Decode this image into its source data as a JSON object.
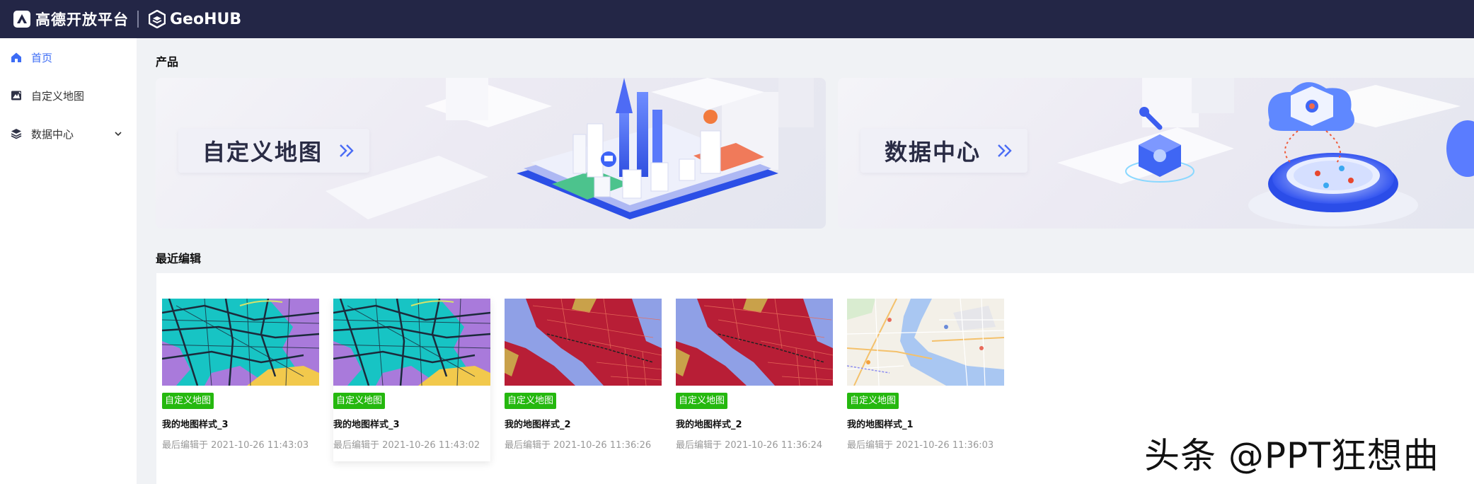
{
  "header": {
    "brand_name": "高德开放平台",
    "product_name": "GeoHUB"
  },
  "sidebar": {
    "items": [
      {
        "label": "首页",
        "icon": "home-icon",
        "active": true
      },
      {
        "label": "自定义地图",
        "icon": "custom-map-icon",
        "active": false
      },
      {
        "label": "数据中心",
        "icon": "layers-icon",
        "active": false,
        "expandable": true
      }
    ]
  },
  "products": {
    "title": "产品",
    "banners": [
      {
        "label": "自定义地图",
        "arrow_icon": "double-chevron-right-icon"
      },
      {
        "label": "数据中心",
        "arrow_icon": "double-chevron-right-icon"
      }
    ]
  },
  "recent": {
    "title": "最近编辑",
    "cards": [
      {
        "tag": "自定义地图",
        "title": "我的地图样式_3",
        "time": "最后编辑于 2021-10-26 11:43:03"
      },
      {
        "tag": "自定义地图",
        "title": "我的地图样式_3",
        "time": "最后编辑于 2021-10-26 11:43:02"
      },
      {
        "tag": "自定义地图",
        "title": "我的地图样式_2",
        "time": "最后编辑于 2021-10-26 11:36:26"
      },
      {
        "tag": "自定义地图",
        "title": "我的地图样式_2",
        "time": "最后编辑于 2021-10-26 11:36:24"
      },
      {
        "tag": "自定义地图",
        "title": "我的地图样式_1",
        "time": "最后编辑于 2021-10-26 11:36:03"
      }
    ]
  },
  "watermark": "头条 @PPT狂想曲",
  "colors": {
    "header_bg": "#232646",
    "accent": "#3c6cf5",
    "tag_green": "#25b80f",
    "page_bg": "#f0f2f5"
  }
}
